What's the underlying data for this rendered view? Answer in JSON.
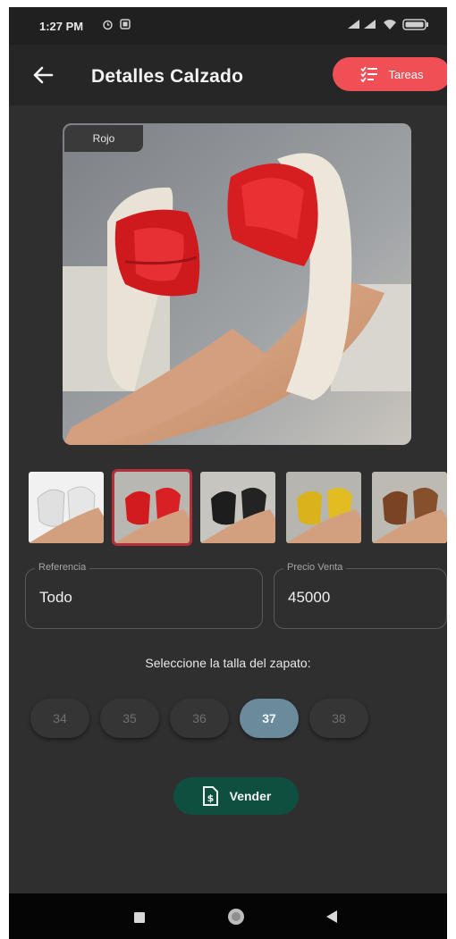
{
  "status_bar": {
    "time": "1:27 PM",
    "left_icons": [
      "alarm-icon",
      "notification-icon"
    ],
    "right_icons": [
      "signal-icon",
      "signal-icon",
      "wifi-icon",
      "battery-icon"
    ]
  },
  "app_bar": {
    "back_icon": "arrow-left-icon",
    "title": "Detalles Calzado",
    "tasks_button": {
      "label": "Tareas",
      "icon": "checklist-icon",
      "color": "#ef4f55"
    }
  },
  "product": {
    "color_tag": "Rojo",
    "thumbnails": [
      {
        "color": "white",
        "selected": false
      },
      {
        "color": "red",
        "selected": true
      },
      {
        "color": "black",
        "selected": false
      },
      {
        "color": "yellow",
        "selected": false
      },
      {
        "color": "brown",
        "selected": false
      }
    ]
  },
  "fields": {
    "reference": {
      "label": "Referencia",
      "value": "Todo"
    },
    "price": {
      "label": "Precio Venta",
      "value": "45000"
    }
  },
  "sizes": {
    "prompt": "Seleccione la talla del zapato:",
    "options": [
      "34",
      "35",
      "36",
      "37",
      "38"
    ],
    "selected": "37",
    "selected_color": "#6b8a9b"
  },
  "sell_button": {
    "label": "Vender",
    "icon": "invoice-dollar-icon",
    "color": "#0f4f3f"
  },
  "nav_bar": {
    "buttons": [
      "recents-square-icon",
      "home-circle-icon",
      "back-triangle-icon"
    ]
  }
}
